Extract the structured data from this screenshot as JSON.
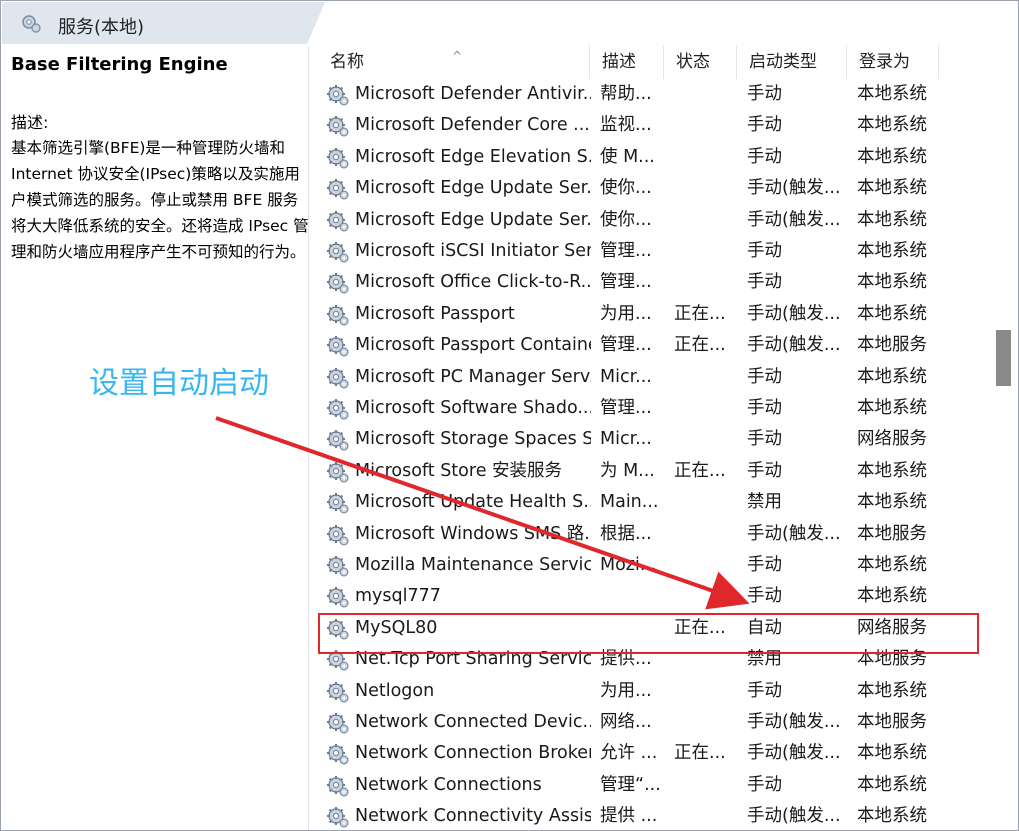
{
  "window": {
    "title": "服务(本地)"
  },
  "description_pane": {
    "service_name": "Base Filtering Engine",
    "label": "描述:",
    "text": "基本筛选引擎(BFE)是一种管理防火墙和 Internet 协议安全(IPsec)策略以及实施用户模式筛选的服务。停止或禁用 BFE 服务将大大降低系统的安全。还将造成 IPsec 管理和防火墙应用程序产生不可预知的行为。"
  },
  "columns": {
    "name": "名称",
    "description": "描述",
    "status": "状态",
    "startup_type": "启动类型",
    "logon_as": "登录为",
    "sort_caret": "^"
  },
  "rows": [
    {
      "name": "Microsoft Defender Antivir...",
      "description": "帮助...",
      "status": "",
      "startup_type": "手动",
      "logon_as": "本地系统"
    },
    {
      "name": "Microsoft Defender Core ...",
      "description": "监视...",
      "status": "",
      "startup_type": "手动",
      "logon_as": "本地系统"
    },
    {
      "name": "Microsoft Edge Elevation S...",
      "description": "使 M...",
      "status": "",
      "startup_type": "手动",
      "logon_as": "本地系统"
    },
    {
      "name": "Microsoft Edge Update Ser...",
      "description": "使你...",
      "status": "",
      "startup_type": "手动(触发...",
      "logon_as": "本地系统"
    },
    {
      "name": "Microsoft Edge Update Ser...",
      "description": "使你...",
      "status": "",
      "startup_type": "手动(触发...",
      "logon_as": "本地系统"
    },
    {
      "name": "Microsoft iSCSI Initiator Ser...",
      "description": "管理...",
      "status": "",
      "startup_type": "手动",
      "logon_as": "本地系统"
    },
    {
      "name": "Microsoft Office Click-to-R...",
      "description": "管理...",
      "status": "",
      "startup_type": "手动",
      "logon_as": "本地系统"
    },
    {
      "name": "Microsoft Passport",
      "description": "为用...",
      "status": "正在...",
      "startup_type": "手动(触发...",
      "logon_as": "本地系统"
    },
    {
      "name": "Microsoft Passport Container",
      "description": "管理...",
      "status": "正在...",
      "startup_type": "手动(触发...",
      "logon_as": "本地服务"
    },
    {
      "name": "Microsoft PC Manager Serv...",
      "description": "Micr...",
      "status": "",
      "startup_type": "手动",
      "logon_as": "本地系统"
    },
    {
      "name": "Microsoft Software Shado...",
      "description": "管理...",
      "status": "",
      "startup_type": "手动",
      "logon_as": "本地系统"
    },
    {
      "name": "Microsoft Storage Spaces S...",
      "description": "Micr...",
      "status": "",
      "startup_type": "手动",
      "logon_as": "网络服务"
    },
    {
      "name": "Microsoft Store 安装服务",
      "description": "为 M...",
      "status": "正在...",
      "startup_type": "手动",
      "logon_as": "本地系统"
    },
    {
      "name": "Microsoft Update Health S...",
      "description": "Main...",
      "status": "",
      "startup_type": "禁用",
      "logon_as": "本地系统"
    },
    {
      "name": "Microsoft Windows SMS 路...",
      "description": "根据...",
      "status": "",
      "startup_type": "手动(触发...",
      "logon_as": "本地服务"
    },
    {
      "name": "Mozilla Maintenance Service",
      "description": "Mozi...",
      "status": "",
      "startup_type": "手动",
      "logon_as": "本地系统"
    },
    {
      "name": "mysql777",
      "description": "",
      "status": "",
      "startup_type": "手动",
      "logon_as": "本地系统"
    },
    {
      "name": "MySQL80",
      "description": "",
      "status": "正在...",
      "startup_type": "自动",
      "logon_as": "网络服务"
    },
    {
      "name": "Net.Tcp Port Sharing Service",
      "description": "提供...",
      "status": "",
      "startup_type": "禁用",
      "logon_as": "本地服务"
    },
    {
      "name": "Netlogon",
      "description": "为用...",
      "status": "",
      "startup_type": "手动",
      "logon_as": "本地系统"
    },
    {
      "name": "Network Connected Devic...",
      "description": "网络...",
      "status": "",
      "startup_type": "手动(触发...",
      "logon_as": "本地服务"
    },
    {
      "name": "Network Connection Broker",
      "description": "允许 ...",
      "status": "正在...",
      "startup_type": "手动(触发...",
      "logon_as": "本地系统"
    },
    {
      "name": "Network Connections",
      "description": "管理“...",
      "status": "",
      "startup_type": "手动",
      "logon_as": "本地系统"
    },
    {
      "name": "Network Connectivity Assis...",
      "description": "提供 ...",
      "status": "",
      "startup_type": "手动(触发...",
      "logon_as": "本地系统"
    }
  ],
  "annotation": {
    "text": "设置自动启动",
    "color": "#37b6f0",
    "arrow_color": "#e0272b"
  },
  "highlight": {
    "row_name": "MySQL80",
    "color": "#e0272b"
  },
  "icons": {
    "header": "services-gear-icon",
    "row": "service-gear-icon"
  }
}
